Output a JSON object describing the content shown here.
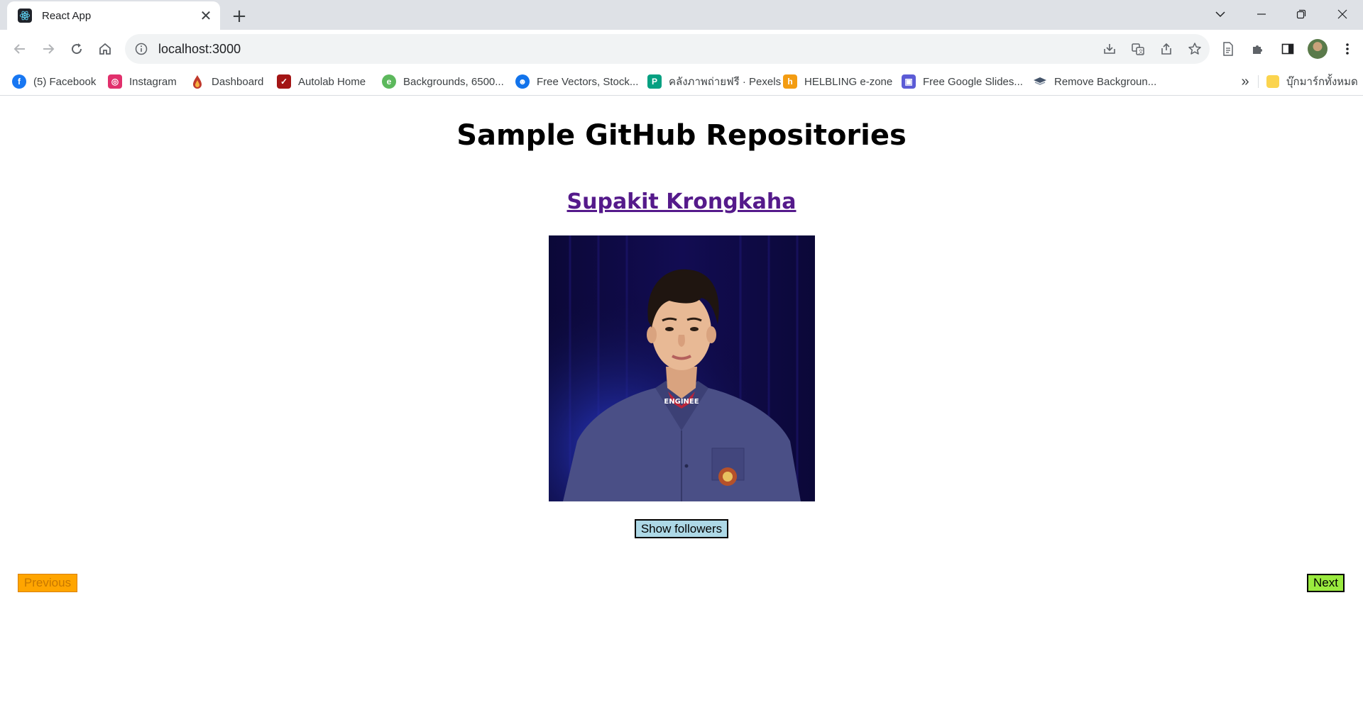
{
  "browser": {
    "tab": {
      "title": "React App",
      "favicon": "react-icon",
      "close_glyph": "✕"
    },
    "new_tab_glyph": "+",
    "window_controls": [
      "tab-search-icon",
      "minimize-icon",
      "restore-icon",
      "close-icon"
    ],
    "address": {
      "url": "localhost:3000",
      "security_icon": "info-icon"
    },
    "omnibox_icons": [
      "install-icon",
      "translate-icon",
      "share-icon",
      "star-icon"
    ],
    "toolbar_icons": [
      "reading-mode-icon",
      "extensions-icon",
      "side-panel-icon",
      "profile-avatar",
      "menu-icon"
    ],
    "bookmarks": [
      {
        "label": "(5) Facebook",
        "icon": "facebook-icon",
        "color": "#1877f2"
      },
      {
        "label": "Instagram",
        "icon": "instagram-icon",
        "color": "#e1306c"
      },
      {
        "label": "Dashboard",
        "icon": "dashboard-icon",
        "color": "#c0392b"
      },
      {
        "label": "Autolab Home",
        "icon": "autolab-icon",
        "color": "#a31515"
      },
      {
        "label": "Backgrounds, 6500...",
        "icon": "backgrounds-icon",
        "color": "#5cb85c"
      },
      {
        "label": "Free Vectors, Stock...",
        "icon": "freepik-icon",
        "color": "#1273eb"
      },
      {
        "label": "คลังภาพถ่ายฟรี · Pexels",
        "icon": "pexels-icon",
        "color": "#05a081"
      },
      {
        "label": "HELBLING e-zone",
        "icon": "helbling-icon",
        "color": "#c0392b"
      },
      {
        "label": "Free Google Slides...",
        "icon": "slides-icon",
        "color": "#5b5bd6"
      },
      {
        "label": "Remove Backgroun...",
        "icon": "removebg-icon",
        "color": "#44546a"
      }
    ],
    "bookmarks_overflow": "»",
    "all_bookmarks": {
      "label": "บุ๊กมาร์กทั้งหมด",
      "icon": "folder-icon",
      "color": "#fbd44e"
    }
  },
  "page": {
    "title": "Sample GitHub Repositories",
    "profile_name": "Supakit Krongkaha",
    "photo_shirt_text": "ENGINEE",
    "show_followers_label": "Show followers",
    "previous_label": "Previous",
    "next_label": "Next"
  }
}
